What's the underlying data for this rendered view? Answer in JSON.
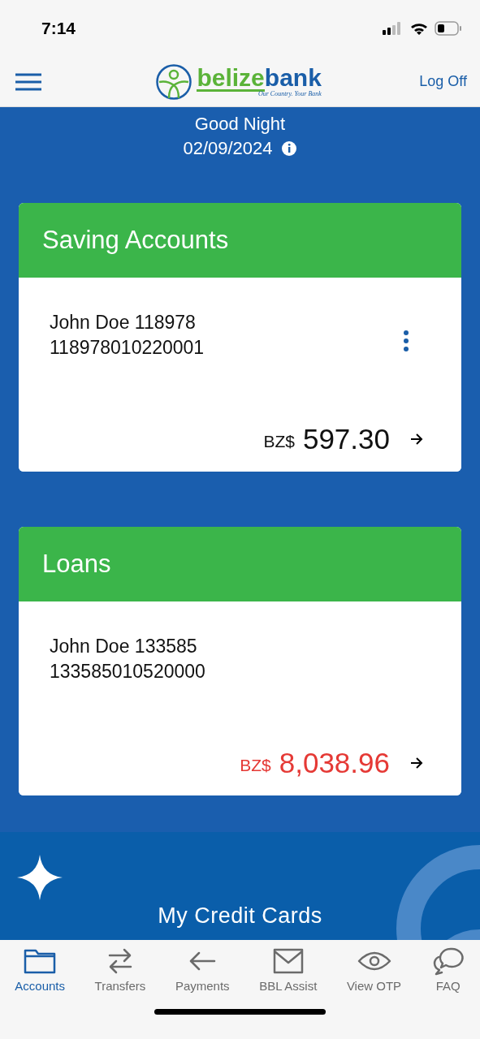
{
  "status_bar": {
    "time": "7:14"
  },
  "header": {
    "brand_left": "belize",
    "brand_right": "bank",
    "tagline": "Our Country. Your Bank",
    "logoff": "Log Off"
  },
  "greeting": {
    "title": "Good Night",
    "date": "02/09/2024"
  },
  "sections": [
    {
      "title": "Saving Accounts",
      "account_name": "John Doe 118978",
      "account_number": "118978010220001",
      "currency": "BZ$",
      "amount": "597.30",
      "negative": false,
      "menu": true
    },
    {
      "title": "Loans",
      "account_name": "John Doe 133585",
      "account_number": "133585010520000",
      "currency": "BZ$",
      "amount": "8,038.96",
      "negative": true,
      "menu": false
    }
  ],
  "promo": {
    "title": "My Credit Cards"
  },
  "nav": [
    {
      "label": "Accounts",
      "selected": true
    },
    {
      "label": "Transfers",
      "selected": false
    },
    {
      "label": "Payments",
      "selected": false
    },
    {
      "label": "BBL Assist",
      "selected": false
    },
    {
      "label": "View OTP",
      "selected": false
    },
    {
      "label": "FAQ",
      "selected": false
    }
  ]
}
